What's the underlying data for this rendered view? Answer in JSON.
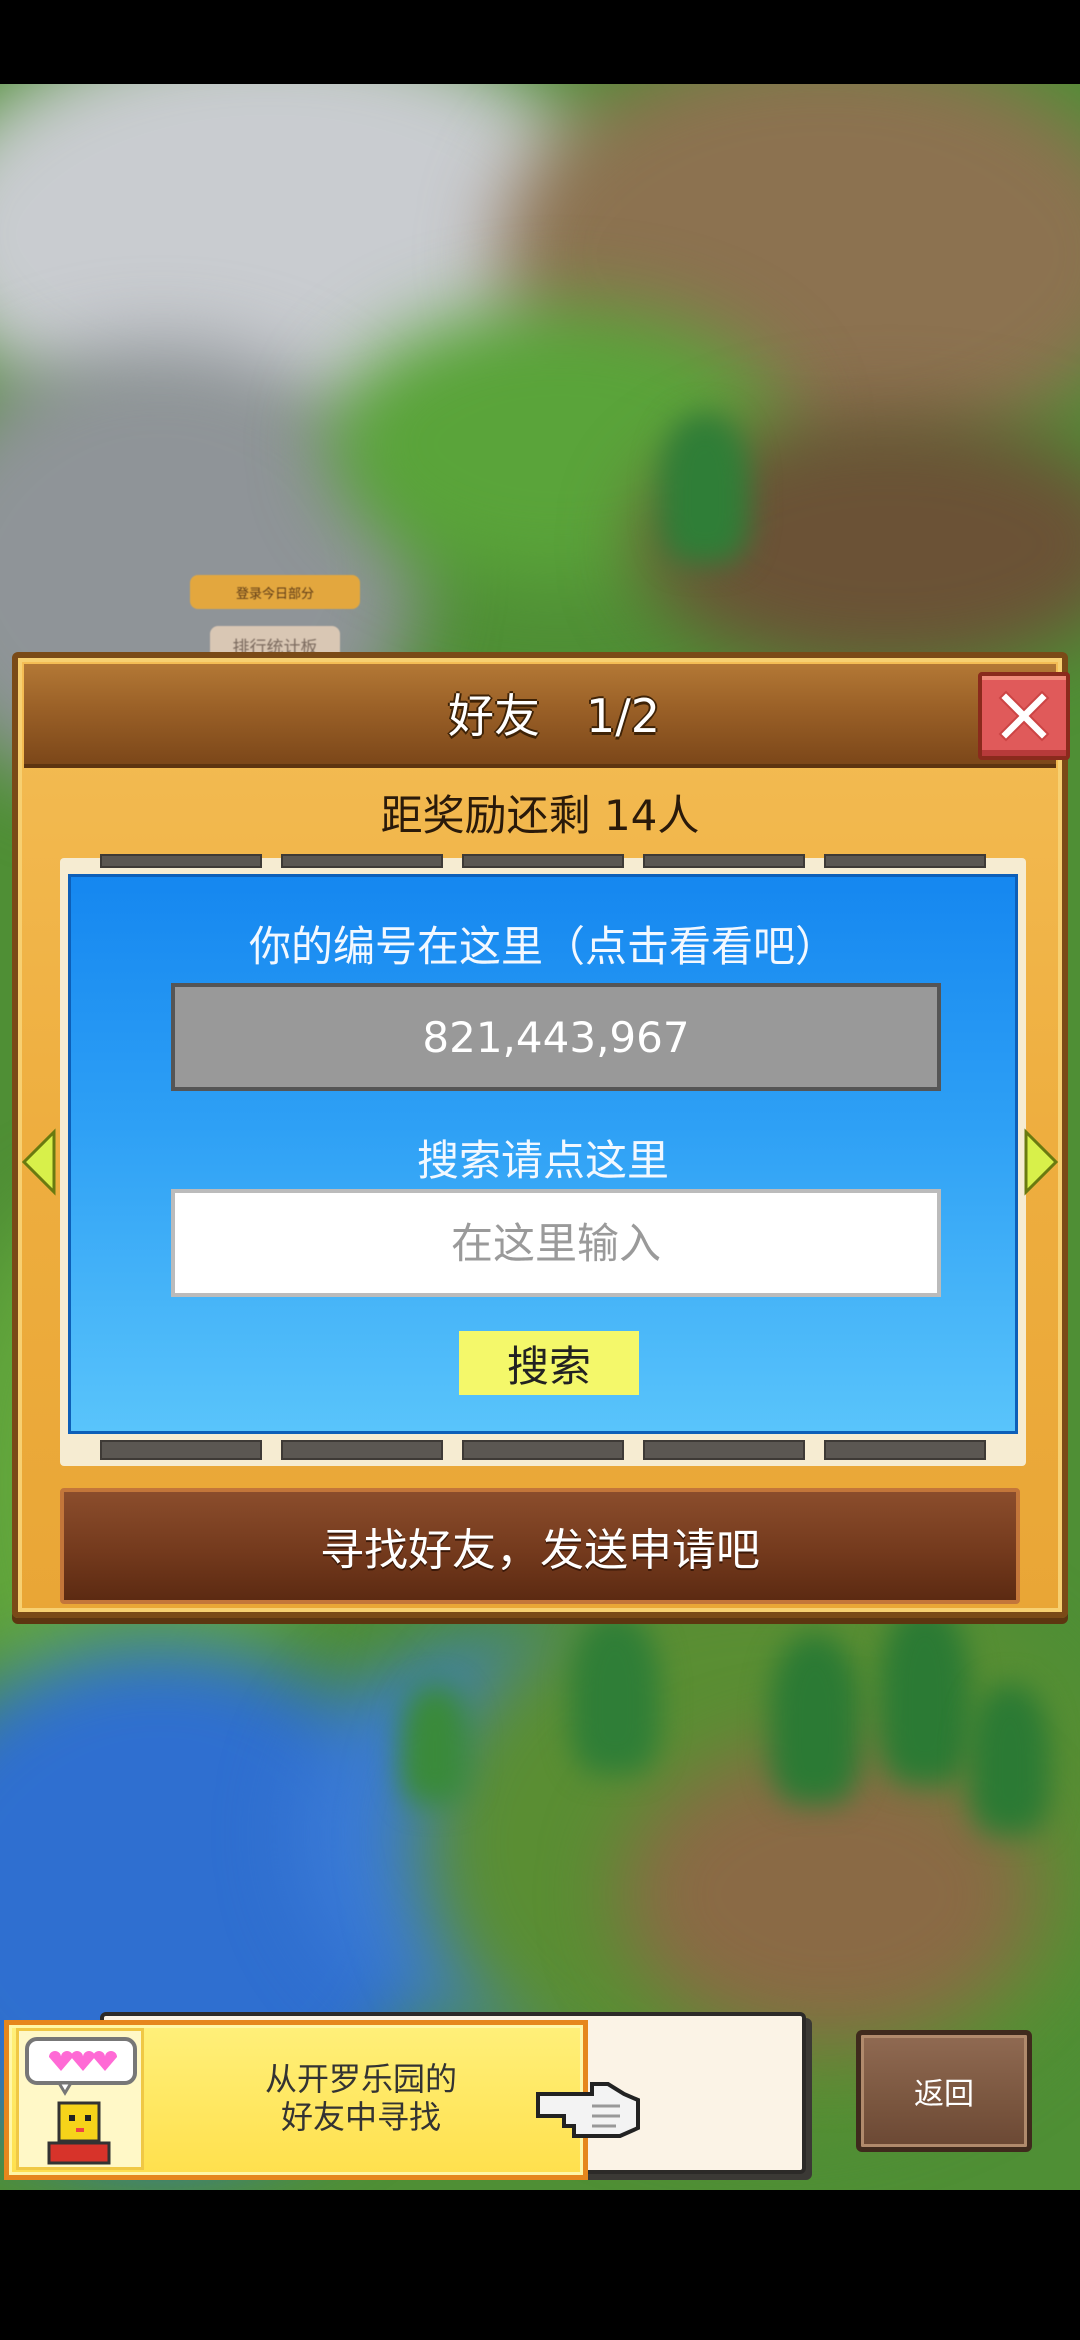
{
  "background": {
    "ghost_login_label": "登录今日部分",
    "ghost_rank_label": "排行统计板"
  },
  "dialog": {
    "title": "好友　1/2",
    "reward_status": "距奖励还剩 14人",
    "id_caption": "你的编号在这里（点击看看吧）",
    "id_value": "821,443,967",
    "search_caption": "搜索请点这里",
    "search_placeholder": "在这里输入",
    "search_button": "搜索",
    "find_friends_button": "寻找好友，发送申请吧",
    "close_icon": "close-x-icon"
  },
  "banner": {
    "line1": "从开罗乐园的",
    "line2": "好友中寻找",
    "character_icon": "pixel-character-icon",
    "pointer_icon": "pointing-hand-icon"
  },
  "navigation": {
    "back_button": "返回",
    "left_arrow_icon": "arrow-left-icon",
    "right_arrow_icon": "arrow-right-icon"
  },
  "colors": {
    "panel_blue": "#1587f0",
    "dialog_gold": "#f4bd55",
    "header_brown": "#9a6027",
    "close_red": "#e05a5a",
    "search_yellow": "#f4f86a"
  }
}
